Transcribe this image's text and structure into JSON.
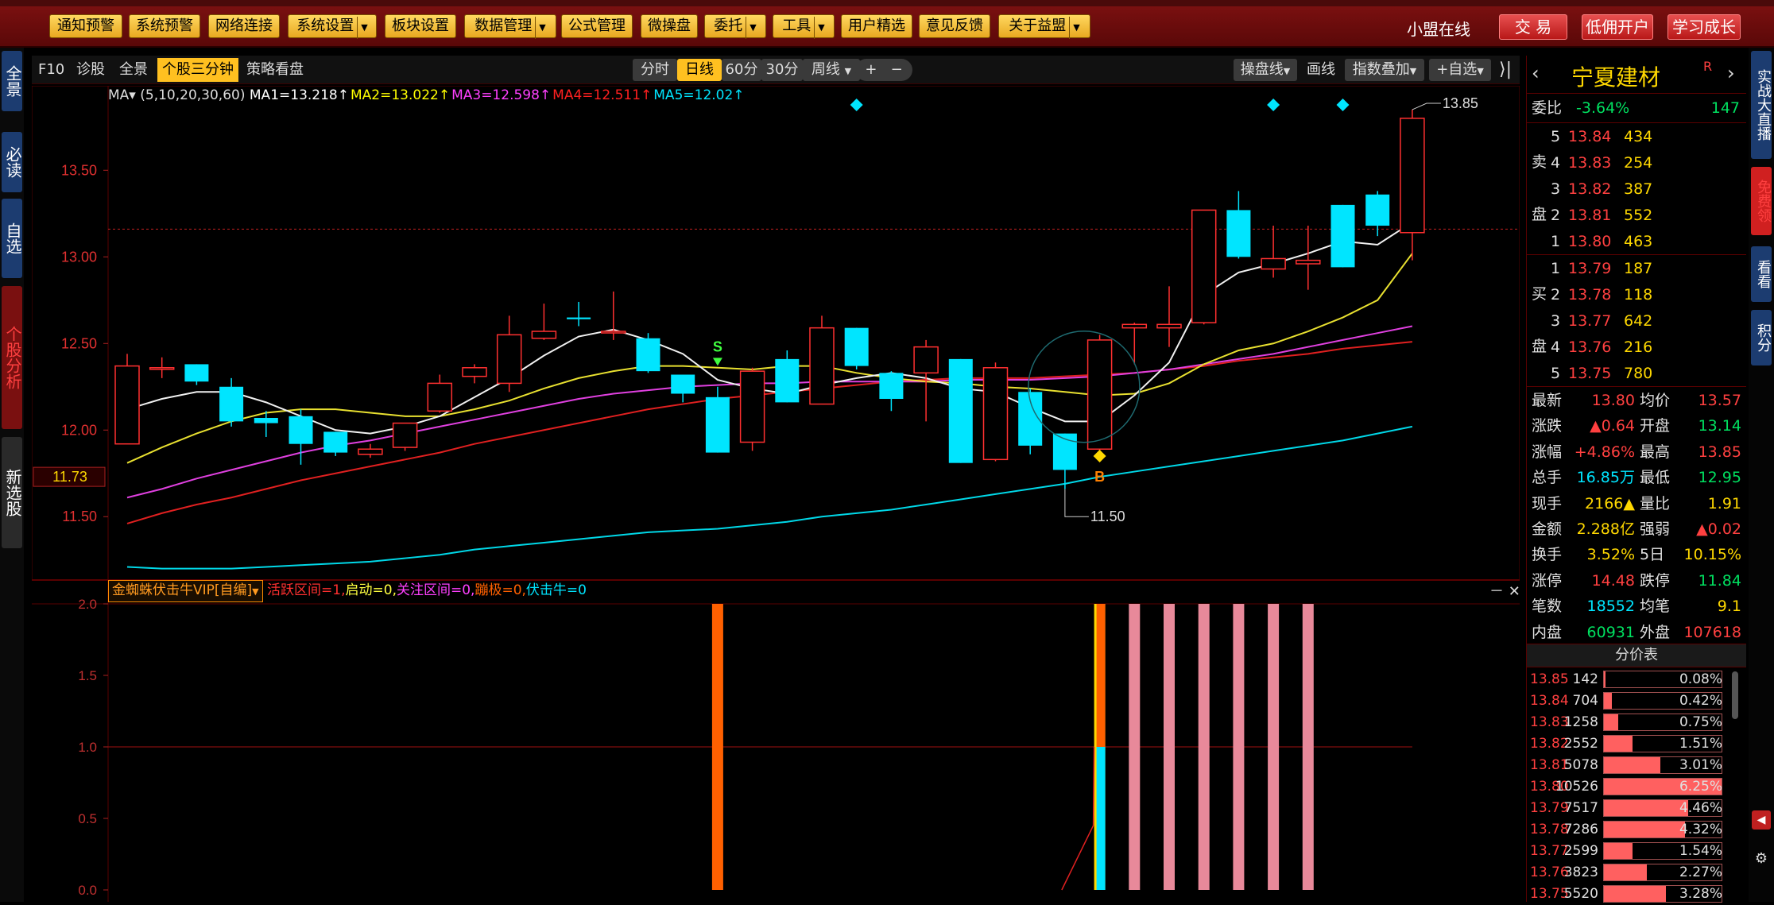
{
  "toolbar": {
    "buttons": [
      "通知预警",
      "系统预警",
      "网络连接",
      "系统设置",
      "板块设置",
      "数据管理",
      "公式管理",
      "微操盘",
      "委托",
      "工具",
      "用户精选",
      "意见反馈",
      "关于益盟"
    ],
    "online_status": "小盟在线",
    "right_buttons": [
      "交 易",
      "低佣开户",
      "学习成长"
    ]
  },
  "left_tabs": [
    "全景",
    "必读",
    "自选",
    "个股分析",
    "新选股"
  ],
  "right_tabs": [
    "实战大直播",
    "免费领",
    "看看",
    "积分"
  ],
  "chart_tabs": {
    "items": [
      "F10",
      "诊股",
      "全景",
      "个股三分钟",
      "策略看盘"
    ],
    "active": "个股三分钟",
    "periods": [
      "分时",
      "日线",
      "60分",
      "30分",
      "周线"
    ],
    "active_period": "日线",
    "zoom_in": "+",
    "zoom_out": "−",
    "right_items": [
      "操盘线",
      "画线",
      "指数叠加",
      "+自选"
    ]
  },
  "ma_legend": {
    "label": "MA▾",
    "params": "(5,10,20,30,60)",
    "items": [
      {
        "text": "MA1=13.218↑",
        "color": "#ffffff"
      },
      {
        "text": "MA2=13.022↑",
        "color": "#ffff00"
      },
      {
        "text": "MA3=12.598↑",
        "color": "#ff40ff"
      },
      {
        "text": "MA4=12.511↑",
        "color": "#ff2020"
      },
      {
        "text": "MA5=12.02↑",
        "color": "#00e5ff"
      }
    ]
  },
  "chart_data": {
    "type": "candlestick",
    "price_ticks": [
      "13.50",
      "13.00",
      "12.50",
      "12.00",
      "11.50"
    ],
    "price_tick_values": [
      13.5,
      13.0,
      12.5,
      12.0,
      11.5
    ],
    "ylim": [
      11.18,
      13.85
    ],
    "current_price_marker": "11.73",
    "current_price_line": 13.16,
    "high_label": "13.85",
    "low_label": "11.50",
    "signals": [
      {
        "label": "S",
        "index": 17,
        "price": 12.38
      },
      {
        "label": "B",
        "index": 28,
        "price": 11.85
      }
    ],
    "candles": [
      [
        11.92,
        12.37,
        12.44,
        11.92
      ],
      [
        12.36,
        12.36,
        12.42,
        12.3
      ],
      [
        12.38,
        12.28,
        12.38,
        12.26
      ],
      [
        12.25,
        12.05,
        12.3,
        12.02
      ],
      [
        12.07,
        12.04,
        12.11,
        11.96
      ],
      [
        12.08,
        11.92,
        12.12,
        11.8
      ],
      [
        11.99,
        11.87,
        11.99,
        11.85
      ],
      [
        11.86,
        11.89,
        11.92,
        11.84
      ],
      [
        11.9,
        12.04,
        12.04,
        11.88
      ],
      [
        12.11,
        12.27,
        12.32,
        12.1
      ],
      [
        12.31,
        12.36,
        12.38,
        12.27
      ],
      [
        12.27,
        12.55,
        12.66,
        12.22
      ],
      [
        12.53,
        12.57,
        12.73,
        12.52
      ],
      [
        12.65,
        12.64,
        12.74,
        12.6
      ],
      [
        12.57,
        12.57,
        12.8,
        12.52
      ],
      [
        12.53,
        12.34,
        12.56,
        12.33
      ],
      [
        12.32,
        12.21,
        12.32,
        12.16
      ],
      [
        12.19,
        11.87,
        12.25,
        11.87
      ],
      [
        11.93,
        12.34,
        12.36,
        11.88
      ],
      [
        12.41,
        12.16,
        12.46,
        12.16
      ],
      [
        12.15,
        12.59,
        12.66,
        12.15
      ],
      [
        12.59,
        12.37,
        12.59,
        12.35
      ],
      [
        12.33,
        12.18,
        12.34,
        12.11
      ],
      [
        12.33,
        12.48,
        12.52,
        12.05
      ],
      [
        12.41,
        11.81,
        12.41,
        11.81
      ],
      [
        11.83,
        12.36,
        12.39,
        11.82
      ],
      [
        12.22,
        11.91,
        12.24,
        11.86
      ],
      [
        11.98,
        11.77,
        11.98,
        11.66
      ],
      [
        11.89,
        12.52,
        12.55,
        11.88
      ],
      [
        12.59,
        12.61,
        12.62,
        12.38
      ],
      [
        12.59,
        12.61,
        12.83,
        12.48
      ],
      [
        12.62,
        13.27,
        13.27,
        12.61
      ],
      [
        13.27,
        13.0,
        13.38,
        12.99
      ],
      [
        12.93,
        12.99,
        13.18,
        12.88
      ],
      [
        12.96,
        12.98,
        13.18,
        12.81
      ],
      [
        13.3,
        12.94,
        13.3,
        12.94
      ],
      [
        13.36,
        13.18,
        13.38,
        13.12
      ],
      [
        13.14,
        13.8,
        13.85,
        12.98
      ]
    ],
    "ma1": [
      12.12,
      12.18,
      12.22,
      12.22,
      12.16,
      12.08,
      12.0,
      11.98,
      12.02,
      12.08,
      12.19,
      12.3,
      12.43,
      12.54,
      12.58,
      12.52,
      12.44,
      12.29,
      12.24,
      12.21,
      12.26,
      12.3,
      12.33,
      12.3,
      12.24,
      12.22,
      12.13,
      12.05,
      12.05,
      12.2,
      12.39,
      12.78,
      12.91,
      12.96,
      13.02,
      13.09,
      13.07,
      13.2
    ],
    "ma2": [
      11.81,
      11.9,
      11.98,
      12.05,
      12.1,
      12.12,
      12.12,
      12.1,
      12.08,
      12.08,
      12.12,
      12.17,
      12.24,
      12.3,
      12.34,
      12.37,
      12.37,
      12.36,
      12.35,
      12.37,
      12.37,
      12.33,
      12.3,
      12.28,
      12.27,
      12.25,
      12.24,
      12.22,
      12.2,
      12.21,
      12.27,
      12.38,
      12.46,
      12.5,
      12.57,
      12.65,
      12.75,
      13.02
    ],
    "ma3": [
      11.61,
      11.66,
      11.72,
      11.77,
      11.82,
      11.87,
      11.91,
      11.94,
      11.98,
      12.02,
      12.06,
      12.1,
      12.14,
      12.18,
      12.21,
      12.23,
      12.25,
      12.26,
      12.27,
      12.27,
      12.28,
      12.28,
      12.28,
      12.28,
      12.29,
      12.29,
      12.29,
      12.3,
      12.31,
      12.33,
      12.35,
      12.38,
      12.41,
      12.44,
      12.48,
      12.52,
      12.56,
      12.6
    ],
    "ma4": [
      11.46,
      11.52,
      11.57,
      11.61,
      11.66,
      11.71,
      11.75,
      11.79,
      11.83,
      11.87,
      11.92,
      11.96,
      12.0,
      12.04,
      12.08,
      12.12,
      12.15,
      12.18,
      12.2,
      12.22,
      12.24,
      12.26,
      12.28,
      12.29,
      12.3,
      12.3,
      12.3,
      12.31,
      12.32,
      12.33,
      12.35,
      12.37,
      12.4,
      12.42,
      12.44,
      12.47,
      12.49,
      12.51
    ],
    "ma5": [
      11.21,
      11.2,
      11.2,
      11.2,
      11.21,
      11.22,
      11.23,
      11.24,
      11.26,
      11.28,
      11.31,
      11.33,
      11.35,
      11.37,
      11.39,
      11.41,
      11.42,
      11.43,
      11.45,
      11.47,
      11.5,
      11.52,
      11.54,
      11.57,
      11.6,
      11.63,
      11.66,
      11.69,
      11.73,
      11.76,
      11.79,
      11.82,
      11.85,
      11.88,
      11.91,
      11.94,
      11.98,
      12.02
    ],
    "diamond_markers": [
      21,
      33,
      35
    ]
  },
  "indicator": {
    "name": "金蜘蛛伏击牛VIP[自编]",
    "items": [
      {
        "text": "活跃区间=1,",
        "color": "#ff3030"
      },
      {
        "text": "启动=0,",
        "color": "#ffff40"
      },
      {
        "text": "关注区间=0,",
        "color": "#ff40ff"
      },
      {
        "text": "蹦极=0,",
        "color": "#ff6000"
      },
      {
        "text": "伏击牛=0",
        "color": "#00e5ff"
      }
    ],
    "ticks": [
      "2.0",
      "1.5",
      "1.0",
      "0.5",
      "0.0"
    ],
    "tick_values": [
      2.0,
      1.5,
      1.0,
      0.5,
      0.0
    ],
    "bars": [
      {
        "index": 17,
        "value": 2.0,
        "color": "#ff6000"
      },
      {
        "index": 28,
        "value": 2.0,
        "color": "#ffd800",
        "stack": [
          {
            "from": 1.0,
            "to": 2.0,
            "color": "#ff6000"
          },
          {
            "from": 0,
            "to": 1.0,
            "color": "#00e5ff"
          }
        ]
      },
      {
        "index": 29,
        "value": 2.0,
        "color": "#e8899a"
      },
      {
        "index": 30,
        "value": 2.0,
        "color": "#e8899a"
      },
      {
        "index": 31,
        "value": 2.0,
        "color": "#e8899a"
      },
      {
        "index": 32,
        "value": 2.0,
        "color": "#e8899a"
      },
      {
        "index": 33,
        "value": 2.0,
        "color": "#e8899a"
      },
      {
        "index": 34,
        "value": 2.0,
        "color": "#e8899a"
      }
    ]
  },
  "quote": {
    "stock_name": "宁夏建材",
    "flag": "R",
    "weibi_label": "委比",
    "weibi": "-3.64%",
    "weicha": "147",
    "sell": [
      {
        "lvl": "5",
        "price": "13.84",
        "vol": "434"
      },
      {
        "lvl": "4",
        "price": "13.83",
        "vol": "254"
      },
      {
        "lvl": "3",
        "price": "13.82",
        "vol": "387"
      },
      {
        "lvl": "2",
        "price": "13.81",
        "vol": "552"
      },
      {
        "lvl": "1",
        "price": "13.80",
        "vol": "463"
      }
    ],
    "buy": [
      {
        "lvl": "1",
        "price": "13.79",
        "vol": "187"
      },
      {
        "lvl": "2",
        "price": "13.78",
        "vol": "118"
      },
      {
        "lvl": "3",
        "price": "13.77",
        "vol": "642"
      },
      {
        "lvl": "4",
        "price": "13.76",
        "vol": "216"
      },
      {
        "lvl": "5",
        "price": "13.75",
        "vol": "780"
      }
    ],
    "sell_label": [
      "卖",
      "盘"
    ],
    "buy_label": [
      "买",
      "盘"
    ],
    "stats": [
      {
        "l1": "最新",
        "v1": "13.80",
        "c1": "red",
        "l2": "均价",
        "v2": "13.57",
        "c2": "red"
      },
      {
        "l1": "涨跌",
        "v1": "▲0.64",
        "c1": "red",
        "l2": "开盘",
        "v2": "13.14",
        "c2": "grn"
      },
      {
        "l1": "涨幅",
        "v1": "+4.86%",
        "c1": "red",
        "l2": "最高",
        "v2": "13.85",
        "c2": "red"
      },
      {
        "l1": "总手",
        "v1": "16.85万",
        "c1": "cyan",
        "l2": "最低",
        "v2": "12.95",
        "c2": "grn"
      },
      {
        "l1": "现手",
        "v1": "2166▲",
        "c1": "yel",
        "l2": "量比",
        "v2": "1.91",
        "c2": "yel"
      },
      {
        "l1": "金额",
        "v1": "2.288亿",
        "c1": "yel",
        "l2": "强弱",
        "v2": "▲0.02",
        "c2": "red"
      },
      {
        "l1": "换手",
        "v1": "3.52%",
        "c1": "yel",
        "l2": "5日",
        "v2": "10.15%",
        "c2": "yel"
      },
      {
        "l1": "涨停",
        "v1": "14.48",
        "c1": "red",
        "l2": "跌停",
        "v2": "11.84",
        "c2": "grn"
      },
      {
        "l1": "笔数",
        "v1": "18552",
        "c1": "cyan",
        "l2": "均笔",
        "v2": "9.1",
        "c2": "yel"
      },
      {
        "l1": "内盘",
        "v1": "60931",
        "c1": "grn",
        "l2": "外盘",
        "v2": "107618",
        "c2": "red"
      }
    ],
    "price_table_title": "分价表",
    "price_table": [
      {
        "price": "13.85",
        "vol": "142",
        "pct": "0.08%",
        "frac": 0.0008
      },
      {
        "price": "13.84",
        "vol": "704",
        "pct": "0.42%",
        "frac": 0.0042
      },
      {
        "price": "13.83",
        "vol": "1258",
        "pct": "0.75%",
        "frac": 0.0075
      },
      {
        "price": "13.82",
        "vol": "2552",
        "pct": "1.51%",
        "frac": 0.0151
      },
      {
        "price": "13.81",
        "vol": "5078",
        "pct": "3.01%",
        "frac": 0.0301
      },
      {
        "price": "13.80",
        "vol": "10526",
        "pct": "6.25%",
        "frac": 0.0625
      },
      {
        "price": "13.79",
        "vol": "7517",
        "pct": "4.46%",
        "frac": 0.0446
      },
      {
        "price": "13.78",
        "vol": "7286",
        "pct": "4.32%",
        "frac": 0.0432
      },
      {
        "price": "13.77",
        "vol": "2599",
        "pct": "1.54%",
        "frac": 0.0154
      },
      {
        "price": "13.76",
        "vol": "3823",
        "pct": "2.27%",
        "frac": 0.0227
      },
      {
        "price": "13.75",
        "vol": "5520",
        "pct": "3.28%",
        "frac": 0.0328
      }
    ]
  }
}
